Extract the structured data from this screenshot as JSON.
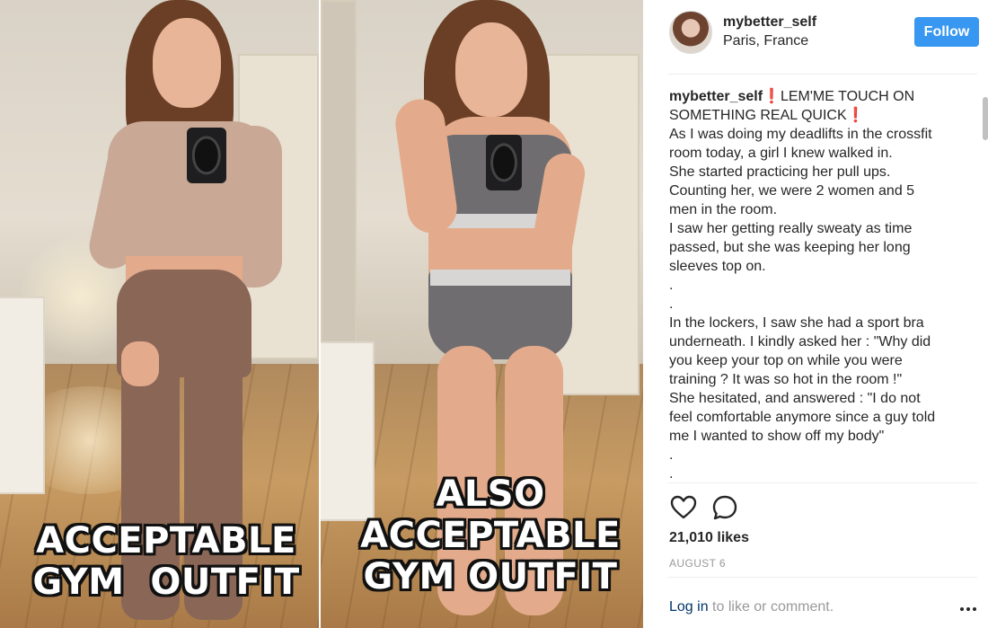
{
  "post": {
    "photo": {
      "left_caption": [
        "ACCEPTABLE",
        "GYM  OUTFIT"
      ],
      "right_caption": [
        "ALSO",
        "ACCEPTABLE",
        "GYM OUTFIT"
      ]
    },
    "author": {
      "username": "mybetter_self",
      "location": "Paris, France",
      "follow_label": "Follow"
    },
    "caption_lines": [
      {
        "user": "mybetter_self",
        "excl": "❗",
        "text": "LEM'ME TOUCH ON"
      },
      {
        "text": "SOMETHING REAL QUICK",
        "excl_after": "❗"
      },
      {
        "text": "As I was doing my deadlifts in the crossfit"
      },
      {
        "text": "room today, a girl I knew walked in."
      },
      {
        "text": "She started practicing her pull ups."
      },
      {
        "text": "Counting her, we were 2 women and 5"
      },
      {
        "text": "men in the room."
      },
      {
        "text": "I saw her getting really sweaty as time"
      },
      {
        "text": "passed, but she was keeping her long"
      },
      {
        "text": "sleeves top on."
      },
      {
        "text": "."
      },
      {
        "text": "."
      },
      {
        "text": "In the lockers, I saw she had a sport bra"
      },
      {
        "text": "underneath. I kindly asked her : \"Why did"
      },
      {
        "text": "you keep your top on while you were"
      },
      {
        "text": "training ? It was so hot in the room !\""
      },
      {
        "text": "She hesitated, and answered : \"I do not"
      },
      {
        "text": "feel comfortable anymore since a guy told"
      },
      {
        "text": "me I wanted to show off my body\""
      },
      {
        "text": "."
      },
      {
        "text": "."
      }
    ],
    "actions": {
      "like_icon": "heart-icon",
      "comment_icon": "comment-icon"
    },
    "likes": "21,010 likes",
    "date": "AUGUST 6",
    "login": {
      "link": "Log in",
      "rest": " to like or comment."
    },
    "more_icon": "more-options-icon",
    "colors": {
      "follow_button": "#3897f0",
      "link": "#003569",
      "muted": "#999999",
      "text": "#262626"
    }
  }
}
